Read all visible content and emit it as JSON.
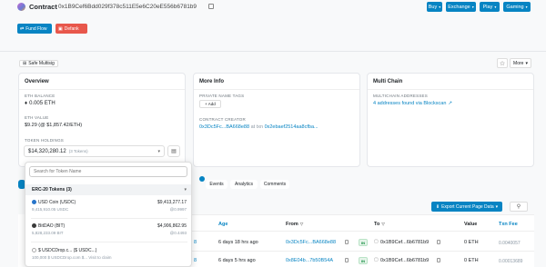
{
  "header": {
    "contract_label": "Contract",
    "address": "0x1B9Cef6Bdd029f378c511E5e6C20eE556b6781b9",
    "buttons": [
      "Buy",
      "Exchange",
      "Play",
      "Gaming"
    ]
  },
  "tags": {
    "fund_flow": "Fund Flow",
    "defank": "Defank"
  },
  "badges": {
    "safe_multisig": "Safe Multisig",
    "more": "More"
  },
  "overview": {
    "title": "Overview",
    "eth_balance_label": "ETH BALANCE",
    "eth_balance": "0.005 ETH",
    "eth_value_label": "ETH VALUE",
    "eth_value": "$9.29 (@ $1,857.42/ETH)",
    "token_holdings_label": "TOKEN HOLDINGS",
    "token_holdings_value": "$14,320,280.12",
    "token_holdings_count": "(3 Tokens)"
  },
  "more_info": {
    "title": "More Info",
    "private_name_tags_label": "PRIVATE NAME TAGS",
    "add_label": "+ Add",
    "contract_creator_label": "CONTRACT CREATOR",
    "creator_addr": "0x3Dc5Fc...BA668e88",
    "at_txn": "at txn",
    "txn_hash": "0x2ebaef2514aa8cfba..."
  },
  "multi_chain": {
    "title": "Multi Chain",
    "addresses_label": "MULTICHAIN ADDRESSES",
    "addresses_value": "4 addresses found via Blockscan"
  },
  "tabs": [
    "Events",
    "Analytics",
    "Comments"
  ],
  "export": {
    "label": "Export Current Page Data",
    "filter_icon": "filter-icon"
  },
  "table": {
    "headers": [
      "Age",
      "From",
      "To",
      "Value",
      "Txn Fee"
    ],
    "rows": [
      {
        "age": "6 days 18 hrs ago",
        "from": "0x3Dc5Fc...BA668e88",
        "dir": "IN",
        "to": "0x1B9Cef...6b6781b9",
        "value": "0 ETH",
        "fee": "0.0040057"
      },
      {
        "age": "6 days 5 hrs ago",
        "from": "0x8E04b...7b50B54A",
        "dir": "IN",
        "to": "0x1B9Cef...6b6781b9",
        "value": "0 ETH",
        "fee": "0.00013689"
      }
    ]
  },
  "dropdown": {
    "search_placeholder": "Search for Token Name",
    "section_label": "ERC-20 Tokens (3)",
    "tokens": [
      {
        "name": "USD Coin (USDC)",
        "amount": "9,415,910.05 USDC",
        "value": "$9,413,277.17",
        "price": "@0.9997"
      },
      {
        "name": "BitDAO (BIT)",
        "amount": "5,828,233.09 BIT",
        "value": "$4,906,862.95",
        "price": "@0.4493"
      },
      {
        "name": "$ USDCDrop.c... ($ USDC...)",
        "amount": "100,000 $ USDCDrop.com $... Visit to claim",
        "value": "",
        "price": ""
      }
    ]
  },
  "colors": {
    "primary": "#0784c3",
    "fund_flow": "#0784c3",
    "defank": "#e8574b",
    "in_badge": "#0a8a3a"
  }
}
